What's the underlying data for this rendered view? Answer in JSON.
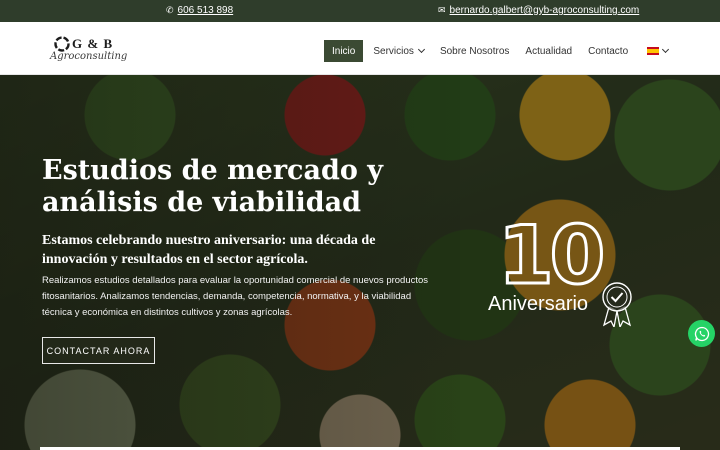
{
  "topbar": {
    "phone_icon": "phone-icon",
    "phone": "606 513 898",
    "email_icon": "envelope-icon",
    "email": "bernardo.galbert@gyb-agroconsulting.com"
  },
  "logo": {
    "name": "G & B",
    "tagline": "Agroconsulting"
  },
  "nav": {
    "items": [
      {
        "label": "Inicio",
        "active": true
      },
      {
        "label": "Servicios",
        "dropdown": true
      },
      {
        "label": "Sobre Nosotros"
      },
      {
        "label": "Actualidad"
      },
      {
        "label": "Contacto"
      }
    ],
    "language_icon": "spain-flag-icon"
  },
  "hero": {
    "title": "Estudios de mercado y análisis de viabilidad",
    "subtitle": "Estamos celebrando nuestro aniversario: una década de innovación y resultados en el sector agrícola.",
    "text": "Realizamos estudios detallados para evaluar la oportunidad comercial de nuevos productos fitosanitarios. Analizamos tendencias, demanda, competencia, normativa, y la viabilidad técnica y económica en distintos cultivos y zonas agrícolas.",
    "cta": "CONTACTAR AHORA"
  },
  "anniversary": {
    "number": "10",
    "label": "Aniversario",
    "badge_icon": "award-ribbon-icon"
  },
  "whatsapp_icon": "whatsapp-icon",
  "colors": {
    "topbar": "#2f3d2b",
    "nav_active": "#3b4a33",
    "whatsapp": "#25d366"
  }
}
